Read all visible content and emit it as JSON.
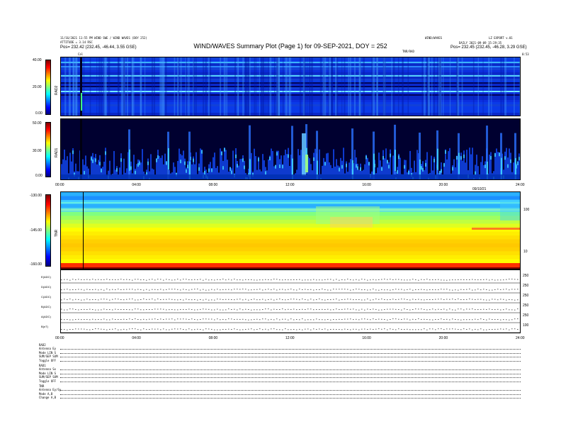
{
  "header": {
    "title": "WIND/WAVES Summary Plot (Page 1) for 09-SEP-2021, DOY = 252",
    "left_line1": "11/16/2021 11:55 PM  WIND SWE / WIND WAVES (DOY 252)",
    "left_line2": "ATTITUDE  = 3.14  RSC",
    "left_line3": "Pos= 232.42 (232.45, -46.44, 3.55 GSE)",
    "right_line1": "WIND/WAVES",
    "right_line2": "DAILY 2021-09-09 15:29:35",
    "right_line3": "Pos= 232.45 (232.45, -46.28, 3.29 GSE)",
    "center_small": "TNR/RAD",
    "far_right_small": "LZ EXPORT v.01",
    "marker_top_left": "Cal",
    "corner_right": "0:53"
  },
  "chart_data": [
    {
      "type": "heatmap",
      "panel": "RAD2",
      "ylabel": "RAD2",
      "yticks": [
        "40.00",
        "20.00",
        "0.00"
      ],
      "y_range": [
        0,
        40
      ]
    },
    {
      "type": "heatmap",
      "panel": "RAD1",
      "ylabel": "RAD1",
      "yticks": [
        "50.00",
        "30.00",
        "0.00"
      ],
      "y_range": [
        0,
        50
      ],
      "xticks": [
        "00:00",
        "04:00",
        "08:00",
        "12:00",
        "16:00",
        "20:00",
        "24:00"
      ],
      "x_corner_label": "09/10/21"
    },
    {
      "type": "heatmap",
      "panel": "TNR",
      "ylabel": "TNR",
      "yticks": [
        "-130.00",
        "-145.00",
        "-160.00"
      ],
      "right_ticks": [
        "100",
        "10"
      ],
      "y_range": [
        -160,
        -130
      ]
    },
    {
      "type": "line",
      "panel": "status",
      "rows": [
        {
          "label": "E(ADC)",
          "right_tick": "250"
        },
        {
          "label": "D(ADC)",
          "right_tick": "250"
        },
        {
          "label": "C(ADC)",
          "right_tick": "250"
        },
        {
          "label": "B(ADC)",
          "right_tick": "250"
        },
        {
          "label": "A(ADC)",
          "right_tick": "250"
        },
        {
          "label": "B(nT)",
          "right_tick": "100"
        }
      ],
      "xticks": [
        "00:00",
        "04:00",
        "08:00",
        "12:00",
        "16:00",
        "20:00",
        "24:00"
      ]
    }
  ],
  "colorbar": {
    "colors": [
      "#7f0000",
      "#ff0000",
      "#ff8000",
      "#ffff00",
      "#80ff80",
      "#00ffff",
      "#0080ff",
      "#0000ff",
      "#00007f"
    ]
  },
  "footer": {
    "rad2": {
      "header": "RAD2",
      "lines": [
        "Antenna   Ey",
        "Mode    LIN S",
        "SUM/SEP   SUM",
        "Toggle    OFF"
      ]
    },
    "rad1": {
      "header": "RAD1",
      "lines": [
        "Antenna   Sx",
        "Mode    LIN S",
        "SUM/SEP   SUM",
        "Toggle    OFF"
      ]
    },
    "tnr": {
      "header": "TNR",
      "lines": [
        "Antenna   Ey/Sy",
        "Mode      A,B",
        "Change    A,B"
      ]
    }
  }
}
